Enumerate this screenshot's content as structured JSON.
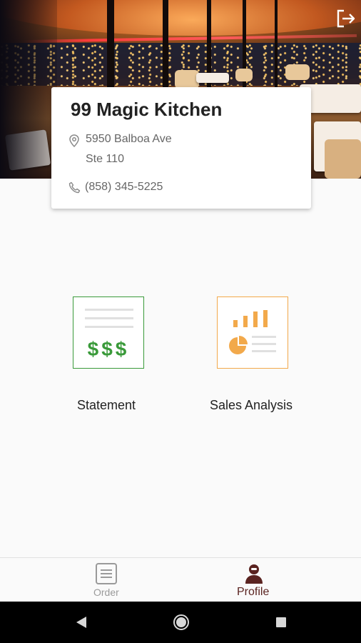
{
  "restaurant": {
    "name": "99 Magic Kitchen",
    "address_line1": "5950 Balboa Ave",
    "address_line2": "Ste 110",
    "phone": "(858) 345-5225"
  },
  "icons": {
    "logout": "logout-icon",
    "location": "location-pin-icon",
    "phone": "phone-icon",
    "statement": "statement-dollars-icon",
    "sales": "sales-chart-icon",
    "order": "order-list-icon",
    "profile": "profile-person-icon"
  },
  "tiles": [
    {
      "label": "Statement"
    },
    {
      "label": "Sales Analysis"
    }
  ],
  "nav": {
    "items": [
      {
        "label": "Order",
        "active": false
      },
      {
        "label": "Profile",
        "active": true
      }
    ]
  },
  "colors": {
    "statement_accent": "#3a9a3a",
    "sales_accent": "#f2a94b",
    "active_nav": "#5a2320",
    "inactive_nav": "#9a9a9a"
  }
}
